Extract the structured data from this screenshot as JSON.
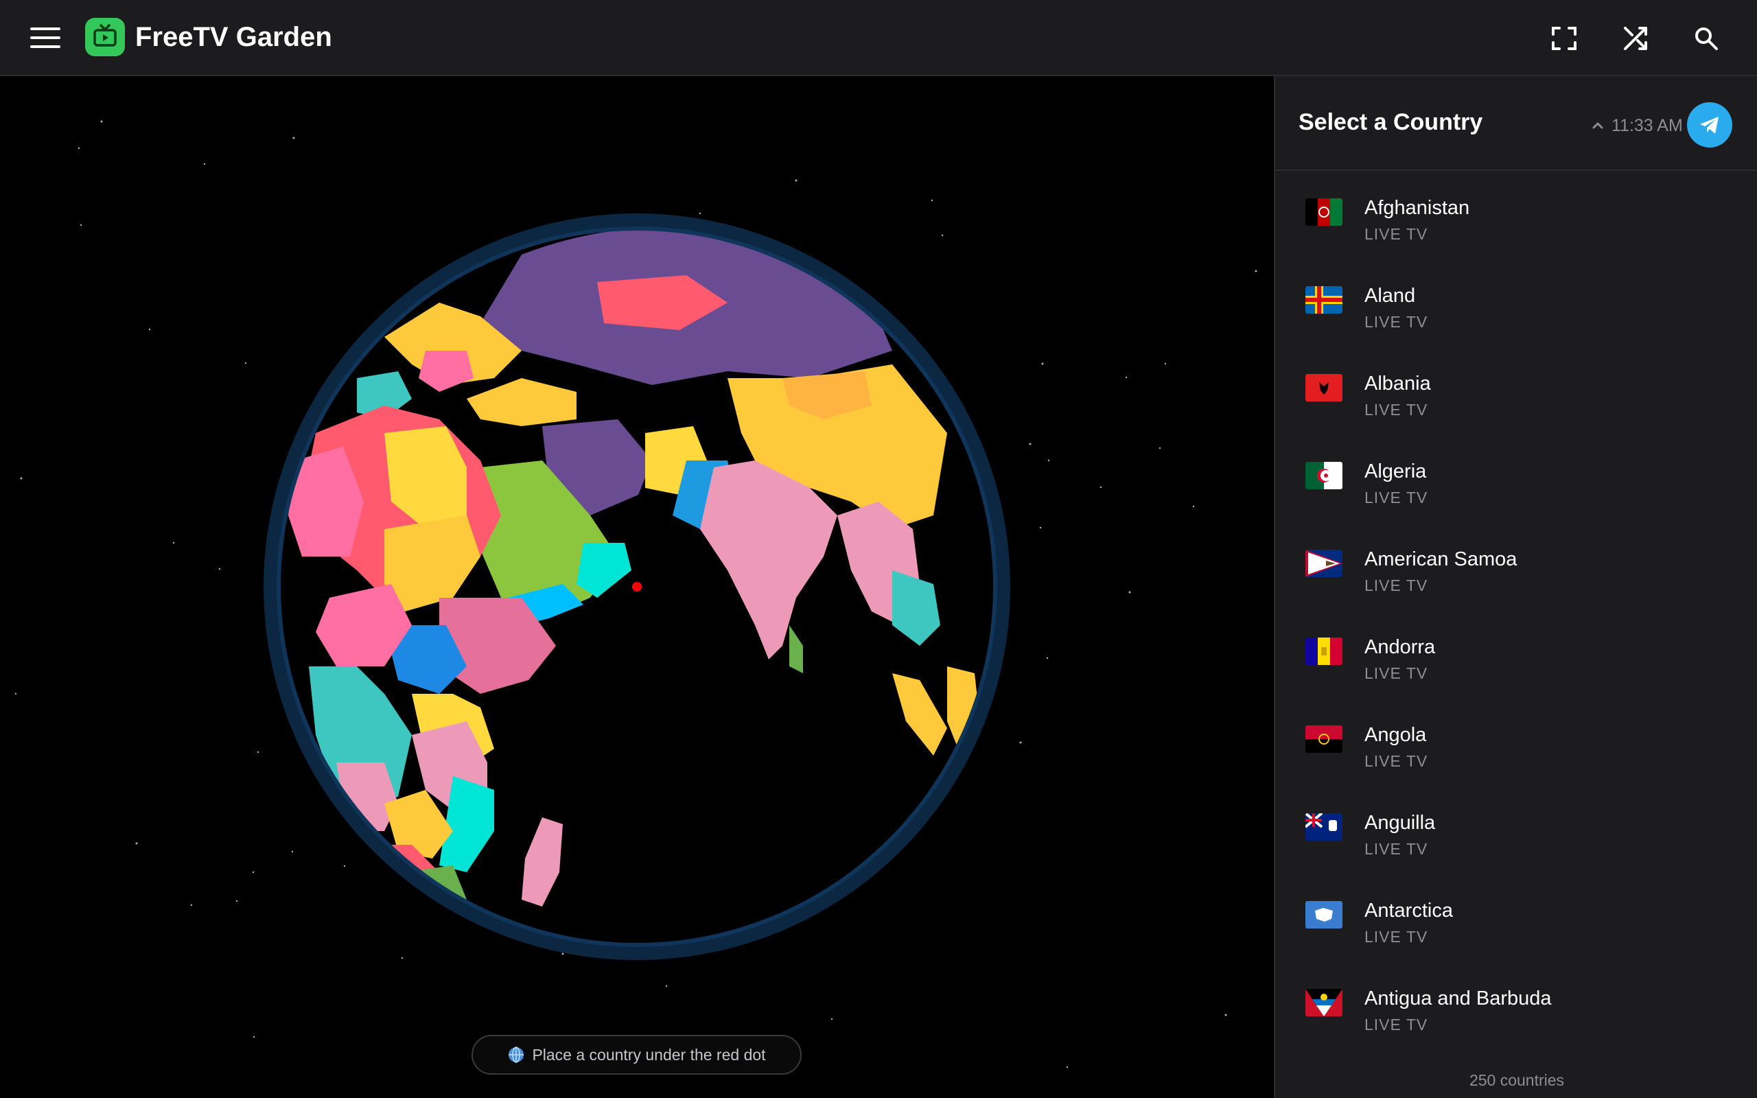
{
  "header": {
    "app_title": "FreeTV Garden",
    "icons": [
      "menu-icon",
      "tv-logo-icon",
      "fullscreen-icon",
      "shuffle-icon",
      "search-icon"
    ]
  },
  "globe": {
    "hint_text": "Place a country under the red dot",
    "hint_icon": "globe-icon",
    "marker_color": "#ff0000"
  },
  "panel": {
    "title": "Select a Country",
    "time": "11:33 AM",
    "count_text": "250 countries",
    "countries": [
      {
        "name": "Afghanistan",
        "sub": "LIVE TV"
      },
      {
        "name": "Aland",
        "sub": "LIVE TV"
      },
      {
        "name": "Albania",
        "sub": "LIVE TV"
      },
      {
        "name": "Algeria",
        "sub": "LIVE TV"
      },
      {
        "name": "American Samoa",
        "sub": "LIVE TV"
      },
      {
        "name": "Andorra",
        "sub": "LIVE TV"
      },
      {
        "name": "Angola",
        "sub": "LIVE TV"
      },
      {
        "name": "Anguilla",
        "sub": "LIVE TV"
      },
      {
        "name": "Antarctica",
        "sub": "LIVE TV"
      },
      {
        "name": "Antigua and Barbuda",
        "sub": "LIVE TV"
      }
    ]
  },
  "colors": {
    "accent_green": "#34c759",
    "telegram_blue": "#2aabee",
    "header_bg": "#1c1c1e"
  }
}
